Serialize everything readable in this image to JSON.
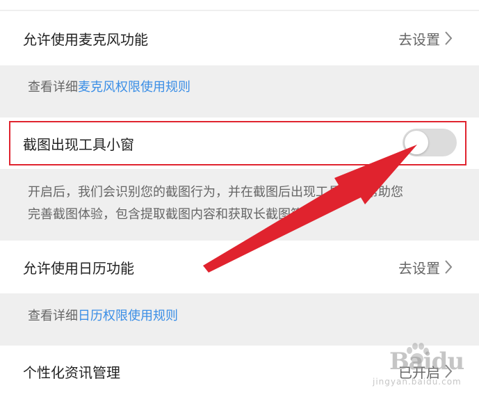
{
  "rows": {
    "mic": {
      "label": "允许使用麦克风功能",
      "action": "去设置"
    },
    "mic_note": {
      "prefix": "查看详细",
      "link": "麦克风权限使用规则"
    },
    "screenshot": {
      "label": "截图出现工具小窗",
      "toggle_on": false
    },
    "screenshot_note": {
      "line1": "开启后，我们会识别您的截图行为，并在截图后出现工具小窗帮助您",
      "line2": "完善截图体验，包含提取截图内容和获取长截图等"
    },
    "calendar": {
      "label": "允许使用日历功能",
      "action": "去设置"
    },
    "calendar_note": {
      "prefix": "查看详细",
      "link": "日历权限使用规则"
    },
    "news": {
      "label": "个性化资讯管理",
      "action": "已开启"
    }
  },
  "annotation": {
    "highlight_color": "#e0232e",
    "arrow_color": "#e0232e"
  },
  "colors": {
    "link": "#3a8ee6",
    "toggle_off": "#dcdcdc",
    "page_bg": "#efefef"
  },
  "watermark": {
    "text": "Baidu",
    "sub": "jingyan.baidu.com"
  }
}
